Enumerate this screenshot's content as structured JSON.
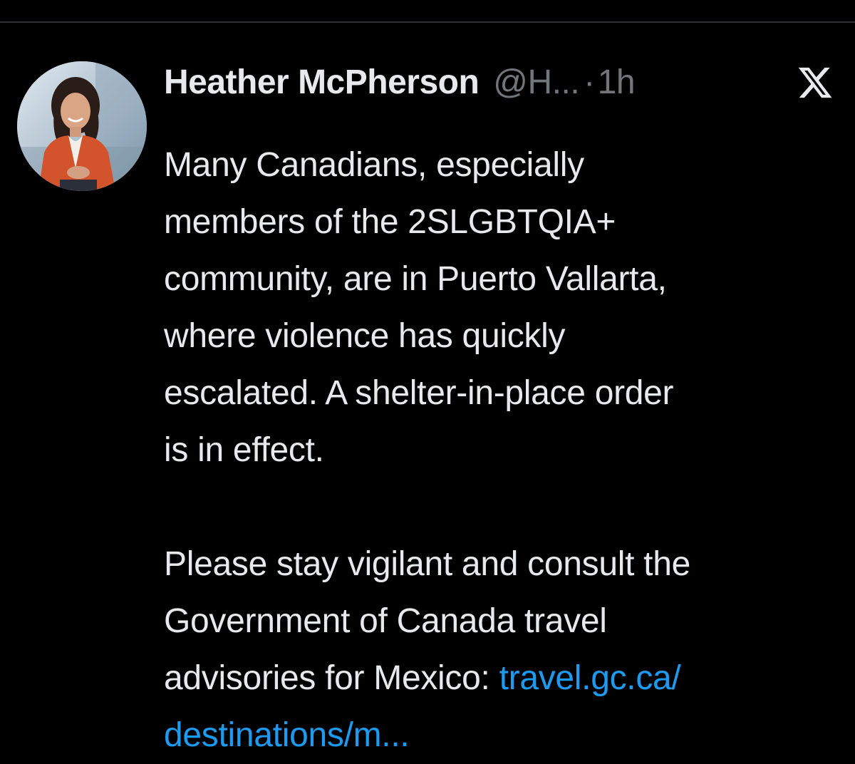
{
  "tweet": {
    "author": {
      "display_name": "Heather McPherson",
      "handle": "@H...",
      "avatar_icon": "profile-photo"
    },
    "separator": "·",
    "timestamp": "1h",
    "platform_icon": "x-logo-icon",
    "body_lines": [
      "Many Canadians, especially",
      "members of the 2SLGBTQIA+",
      "community, are in Puerto Vallarta,",
      "where violence has quickly",
      "escalated. A shelter-in-place order",
      "is in effect.",
      "",
      "Please stay vigilant and consult the",
      "Government of Canada travel"
    ],
    "final_line_text": "advisories for Mexico: ",
    "link_part_1": "travel.gc.ca/",
    "link_part_2": "destinations/m..."
  },
  "colors": {
    "background": "#000000",
    "text_primary": "#e7e9ea",
    "text_secondary": "#71767b",
    "link": "#1d9bf0",
    "divider": "#2f3336"
  }
}
